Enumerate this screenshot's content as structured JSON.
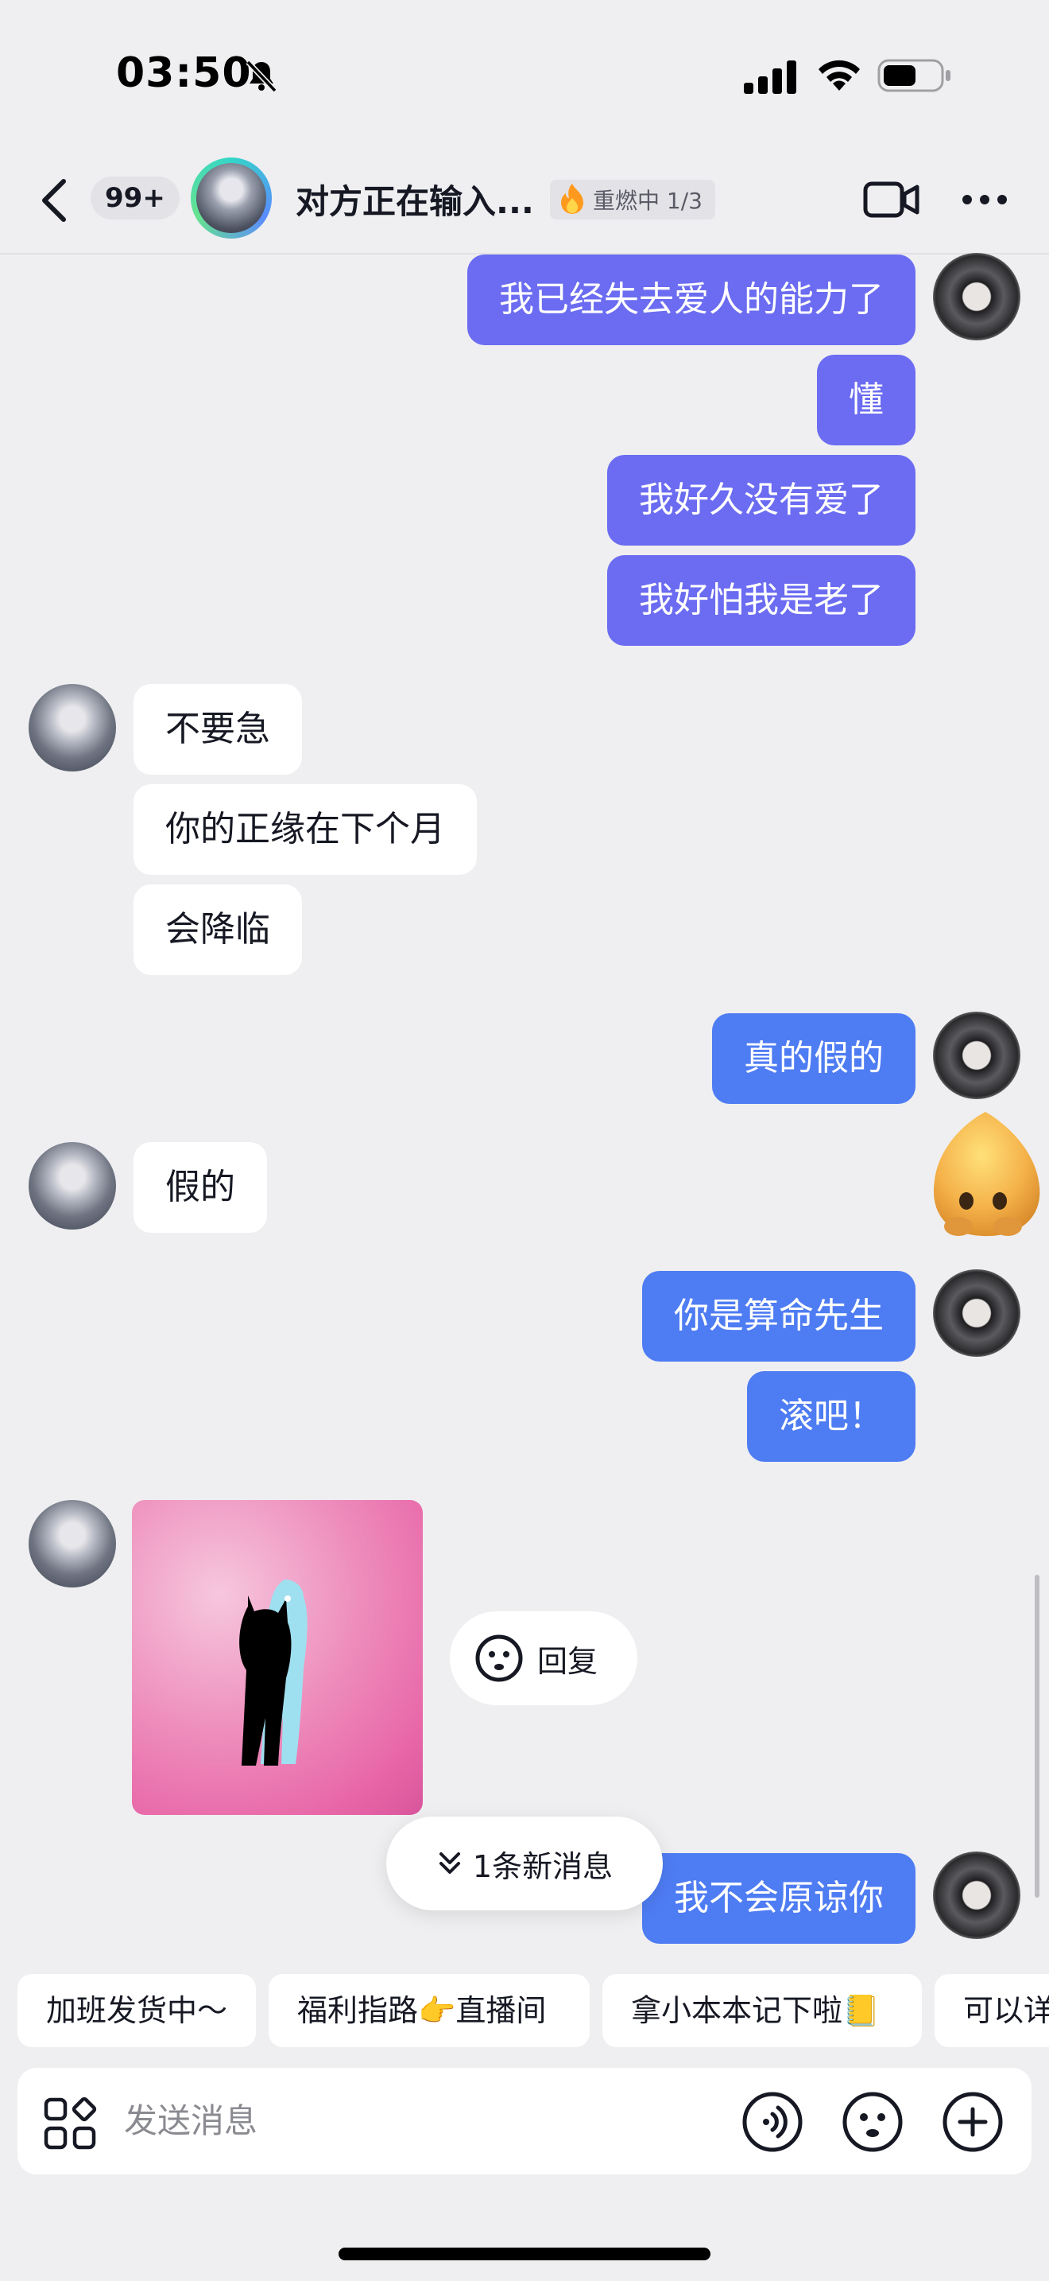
{
  "status_bar": {
    "time": "03:50",
    "icons": [
      "bell-slash-icon",
      "cellular-signal-icon",
      "wifi-icon",
      "battery-icon"
    ]
  },
  "header": {
    "unread_count": "99+",
    "title": "对方正在输入...",
    "fire_badge": "重燃中 1/3",
    "icons": [
      "back-icon",
      "fire-icon",
      "video-call-icon",
      "more-icon"
    ]
  },
  "messages": [
    {
      "from": "me",
      "text": "我已经失去爱人的能力了",
      "color": "#6b6cf1"
    },
    {
      "from": "me",
      "text": "懂",
      "color": "#6b6cf1"
    },
    {
      "from": "me",
      "text": "我好久没有爱了",
      "color": "#6b6cf1"
    },
    {
      "from": "me",
      "text": "我好怕我是老了",
      "color": "#6b6cf1"
    },
    {
      "from": "them",
      "text": "不要急"
    },
    {
      "from": "them",
      "text": "你的正缘在下个月"
    },
    {
      "from": "them",
      "text": "会降临"
    },
    {
      "from": "me",
      "text": "真的假的",
      "color": "#4e7cf3"
    },
    {
      "from": "them",
      "text": "假的"
    },
    {
      "from": "me",
      "text": "你是算命先生",
      "color": "#4e7cf3"
    },
    {
      "from": "me",
      "text": "滚吧！",
      "color": "#4e7cf3"
    },
    {
      "from": "me",
      "text": "我不会原谅你",
      "color": "#4e7cf3"
    }
  ],
  "reply_pill": {
    "label": "回复"
  },
  "new_message_pill": {
    "label": "1条新消息"
  },
  "quick_replies": [
    "加班发货中～",
    "福利指路👉直播间",
    "拿小本本记下啦📒",
    "可以详"
  ],
  "input": {
    "placeholder": "发送消息"
  },
  "colors": {
    "background": "#efeff1",
    "bubble_purple": "#6b6cf1",
    "bubble_blue": "#4e7cf3",
    "bubble_white": "#ffffff"
  }
}
